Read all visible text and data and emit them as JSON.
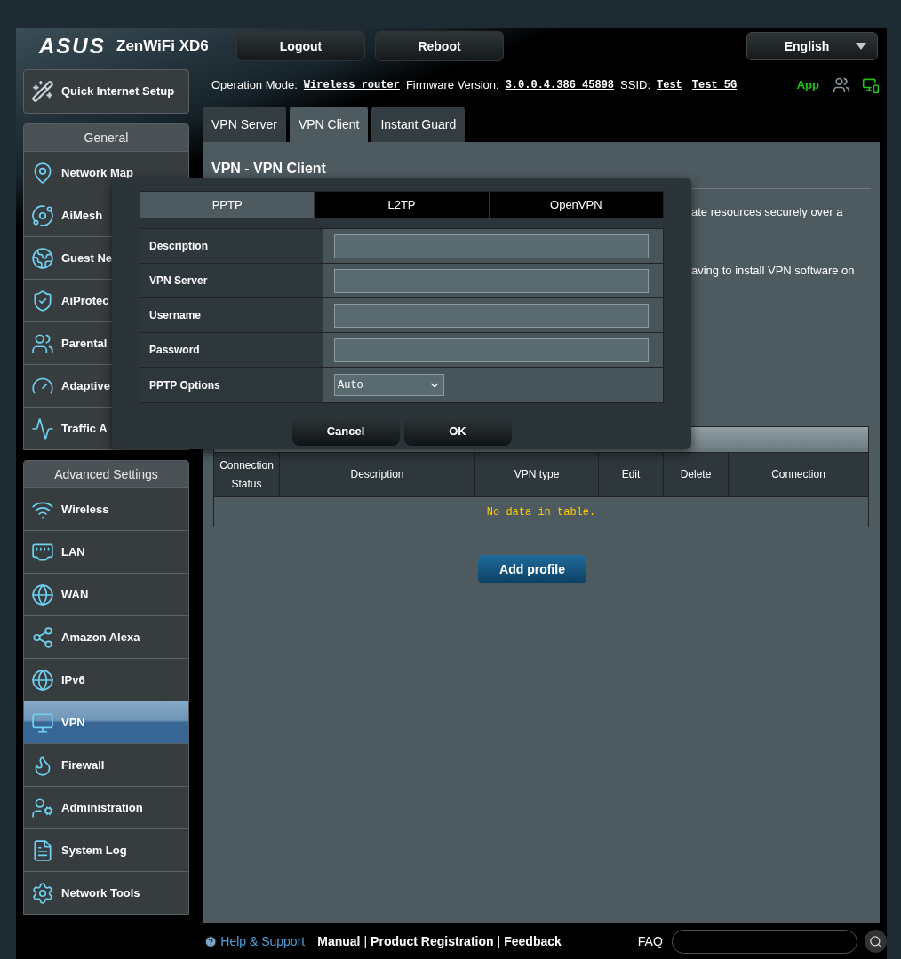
{
  "header": {
    "logo": "ASUS",
    "model": "ZenWiFi XD6",
    "buttons": [
      "Logout",
      "Reboot"
    ],
    "language": "English"
  },
  "status_line": {
    "operation_mode_label": "Operation Mode:",
    "operation_mode": "Wireless router",
    "firmware_label": "Firmware Version:",
    "firmware": "3.0.0.4.386_45898",
    "ssid_label": "SSID:",
    "ssids": [
      "Test",
      "Test_5G"
    ],
    "app": "App"
  },
  "sidebar": {
    "quick_setup": "Quick Internet Setup",
    "sections": [
      {
        "title": "General",
        "items": [
          {
            "label": "Network Map",
            "kind": "globe-pin",
            "selected": false
          },
          {
            "label": "AiMesh",
            "kind": "mesh",
            "selected": false
          },
          {
            "label": "Guest Ne",
            "kind": "globe-people",
            "selected": false
          },
          {
            "label": "AiProtec",
            "kind": "shield",
            "selected": false
          },
          {
            "label": "Parental",
            "kind": "people",
            "selected": false
          },
          {
            "label": "Adaptive",
            "kind": "gauge",
            "selected": false
          },
          {
            "label": "Traffic A",
            "kind": "pulse",
            "selected": false
          }
        ]
      },
      {
        "title": "Advanced Settings",
        "items": [
          {
            "label": "Wireless",
            "kind": "wifi",
            "selected": false
          },
          {
            "label": "LAN",
            "kind": "lan",
            "selected": false
          },
          {
            "label": "WAN",
            "kind": "globe",
            "selected": false
          },
          {
            "label": "Amazon Alexa",
            "kind": "hub",
            "selected": false
          },
          {
            "label": "IPv6",
            "kind": "globe",
            "selected": false
          },
          {
            "label": "VPN",
            "kind": "monitor",
            "selected": true
          },
          {
            "label": "Firewall",
            "kind": "flame",
            "selected": false
          },
          {
            "label": "Administration",
            "kind": "admin",
            "selected": false
          },
          {
            "label": "System Log",
            "kind": "log",
            "selected": false
          },
          {
            "label": "Network Tools",
            "kind": "gear",
            "selected": false
          }
        ]
      }
    ]
  },
  "tabs": [
    {
      "label": "VPN Server",
      "selected": false
    },
    {
      "label": "VPN Client",
      "selected": true
    },
    {
      "label": "Instant Guard",
      "selected": false
    }
  ],
  "page": {
    "title": "VPN - VPN Client",
    "description_fragments": [
      "ate resources securely over a",
      "aving to install VPN software on"
    ]
  },
  "table": {
    "columns": [
      "Connection Status",
      "Description",
      "VPN type",
      "Edit",
      "Delete",
      "Connection"
    ],
    "empty_text": "No data in table."
  },
  "add_button": "Add profile",
  "dialog": {
    "tabs": [
      {
        "label": "PPTP",
        "selected": true
      },
      {
        "label": "L2TP",
        "selected": false
      },
      {
        "label": "OpenVPN",
        "selected": false
      }
    ],
    "fields": [
      {
        "label": "Description",
        "kind": "text"
      },
      {
        "label": "VPN Server",
        "kind": "text"
      },
      {
        "label": "Username",
        "kind": "text"
      },
      {
        "label": "Password",
        "kind": "text"
      },
      {
        "label": "PPTP Options",
        "kind": "select",
        "value": "Auto"
      }
    ],
    "buttons": [
      "Cancel",
      "OK"
    ]
  },
  "footer": {
    "help": "Help & Support",
    "links": [
      "Manual",
      "Product Registration",
      "Feedback"
    ],
    "separators": [
      "|",
      "|"
    ],
    "faq_label": "FAQ"
  }
}
